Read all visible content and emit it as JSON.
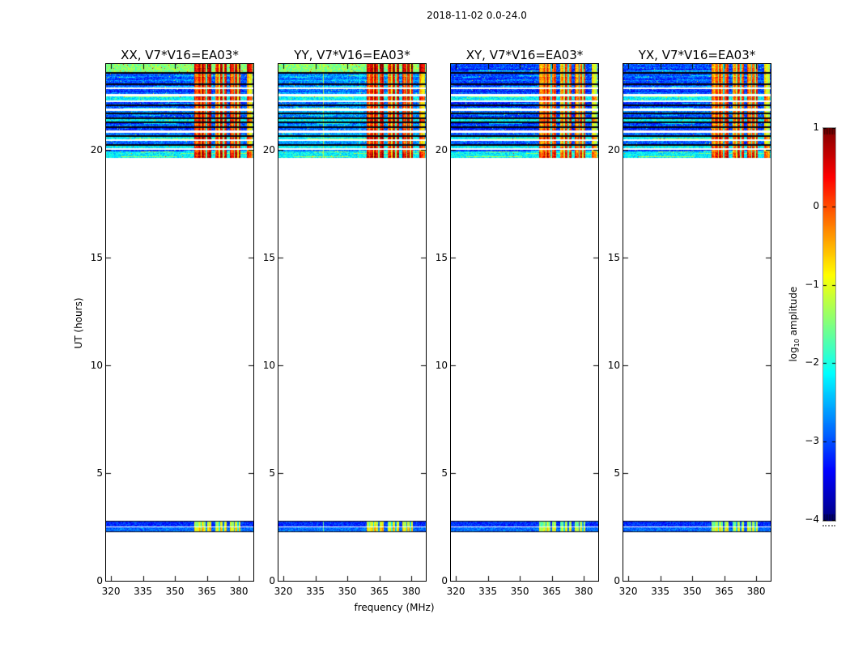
{
  "figure": {
    "title": "2018-11-02 0.0-24.0"
  },
  "chart_data": {
    "type": "heatmap",
    "title": "2018-11-02 0.0-24.0",
    "xlabel": "frequency (MHz)",
    "ylabel": "UT (hours)",
    "x_ticks": [
      320,
      335,
      350,
      365,
      380
    ],
    "y_ticks": [
      0,
      5,
      10,
      15,
      20
    ],
    "x_range_mhz": [
      317.7,
      386.8
    ],
    "y_range_hours": [
      0,
      24
    ],
    "colormap": "jet",
    "panels": [
      {
        "label": "XX, V7*V16=EA03*",
        "pol": "XX",
        "background_log_amp": -2.95,
        "rfi_log_amp": 0.15,
        "has_green_top_row": true
      },
      {
        "label": "YY, V7*V16=EA03*",
        "pol": "YY",
        "background_log_amp": -2.7,
        "rfi_log_amp": 0.2,
        "has_green_top_row": true,
        "vertical_line_mhz": 338.8,
        "faint_vertical_line_mhz": 355.8
      },
      {
        "label": "XY, V7*V16=EA03*",
        "pol": "XY",
        "background_log_amp": -3.05,
        "rfi_log_amp": -0.15,
        "has_green_top_row": false
      },
      {
        "label": "YX, V7*V16=EA03*",
        "pol": "YX",
        "background_log_amp": -3.0,
        "rfi_log_amp": -0.1,
        "has_green_top_row": false
      }
    ],
    "colorbar": {
      "label_prefix": "log",
      "label_sub": "10",
      "label_suffix": " amplitude",
      "ticks": [
        1,
        0,
        -1,
        -2,
        -3,
        -4
      ],
      "vmin": -4,
      "vmax": 1
    },
    "observing_blocks": [
      {
        "ut_start": 19.64,
        "ut_end": 24.0,
        "rfi_bands_mhz": [
          [
            359.2,
            367.2
          ],
          [
            368.9,
            374.2
          ],
          [
            375.7,
            380.7
          ]
        ],
        "rfi_edge_band_mhz": [
          383.6,
          386.6
        ],
        "rfi_notch_mhz": [
          362.3,
          364.9,
          370.9,
          372.7,
          377.9,
          379.6
        ],
        "green_top_row_ut": [
          23.66,
          24.0
        ],
        "green_top_row_log_amp": -1.45,
        "bottom_bright_row_ut": [
          19.64,
          19.95
        ],
        "bright_row_log_amp": -2.15,
        "white_gap_rows_ut": [
          [
            22.84,
            22.93
          ],
          [
            22.53,
            22.62
          ],
          [
            22.25,
            22.34
          ],
          [
            21.85,
            21.94
          ],
          [
            20.83,
            20.92
          ],
          [
            20.43,
            20.52
          ],
          [
            20.04,
            20.11
          ]
        ],
        "black_rows_ut": [
          [
            23.55,
            23.64
          ],
          [
            23.04,
            23.11
          ],
          [
            22.07,
            22.15
          ],
          [
            21.69,
            21.77
          ],
          [
            21.47,
            21.55
          ],
          [
            21.27,
            21.35
          ],
          [
            21.03,
            21.11
          ],
          [
            20.63,
            20.71
          ],
          [
            20.23,
            20.31
          ]
        ],
        "bright_rows_ut": [
          [
            22.34,
            22.53
          ],
          [
            21.35,
            21.47
          ],
          [
            20.52,
            20.63
          ],
          [
            20.11,
            20.23
          ]
        ]
      },
      {
        "ut_start": 2.3,
        "ut_end": 2.78,
        "rfi_bands_mhz": [
          [
            359.2,
            367.2
          ],
          [
            368.9,
            374.2
          ],
          [
            375.7,
            380.7
          ]
        ],
        "rfi_notch_mhz": [
          362.3,
          364.9,
          370.9,
          372.7,
          377.9,
          379.6
        ],
        "rows": [
          {
            "ut": [
              2.55,
              2.78
            ],
            "background_log_amp": -3.15,
            "rfi_offset": -1.25
          },
          {
            "ut": [
              2.3,
              2.53
            ],
            "background_log_amp": -2.85,
            "rfi_offset": -0.85
          }
        ]
      }
    ]
  }
}
